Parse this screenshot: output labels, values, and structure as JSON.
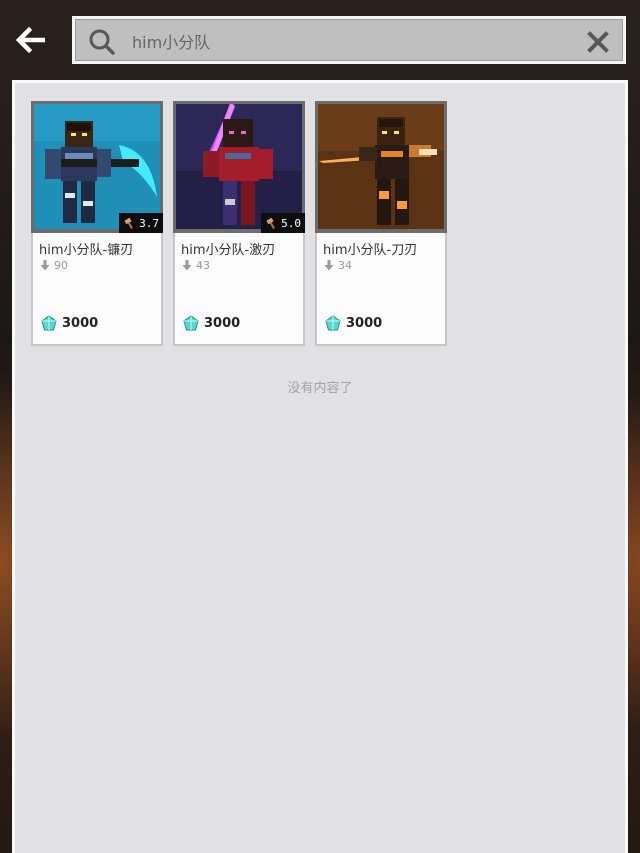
{
  "search": {
    "query": "him小分队",
    "placeholder": ""
  },
  "results": [
    {
      "title": "him小分队-镰刃",
      "downloads": "90",
      "rating": "3.7",
      "price": "3000",
      "accent": "#3fe0f0"
    },
    {
      "title": "him小分队-激刃",
      "downloads": "43",
      "rating": "5.0",
      "price": "3000",
      "accent": "#d040ff"
    },
    {
      "title": "him小分队-刀刃",
      "downloads": "34",
      "rating": "",
      "price": "3000",
      "accent": "#ff9a30"
    }
  ],
  "empty_message": "没有内容了",
  "icons": {
    "back": "arrow-left-icon",
    "search": "magnifier-icon",
    "clear": "close-icon",
    "rating": "hammer-icon",
    "download": "arrow-down-icon",
    "currency": "diamond-icon"
  },
  "colors": {
    "panel": "#e1e1e4",
    "diamond": "#4fd3cf"
  }
}
